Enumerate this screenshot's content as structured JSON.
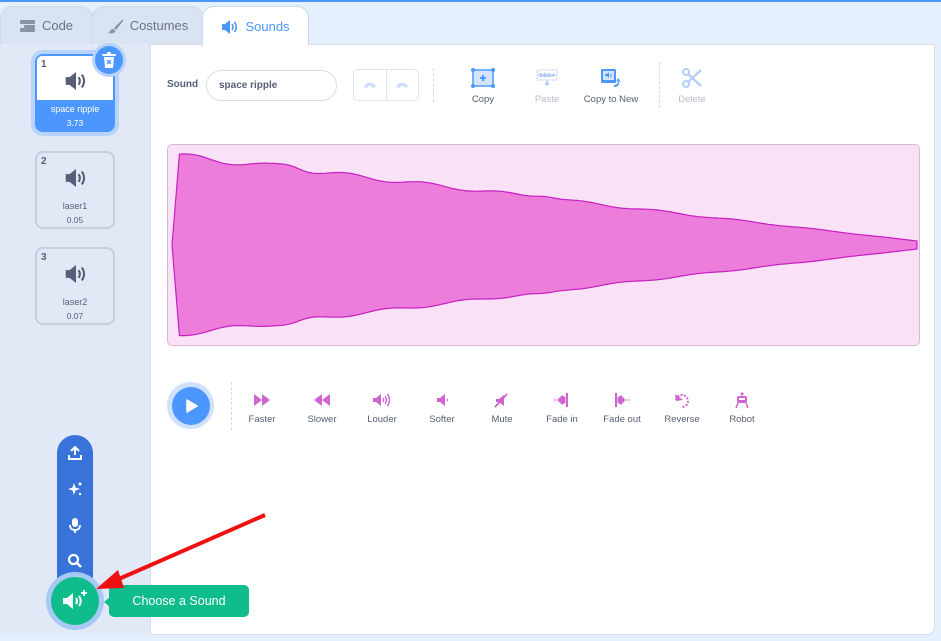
{
  "tabs": [
    {
      "label": "Code",
      "icon": "code-icon",
      "active": false
    },
    {
      "label": "Costumes",
      "icon": "brush-icon",
      "active": false
    },
    {
      "label": "Sounds",
      "icon": "speaker-icon",
      "active": true
    }
  ],
  "sounds": [
    {
      "index": "1",
      "name": "space ripple",
      "duration": "3.73",
      "selected": true
    },
    {
      "index": "2",
      "name": "laser1",
      "duration": "0.05",
      "selected": false
    },
    {
      "index": "3",
      "name": "laser2",
      "duration": "0.07",
      "selected": false
    }
  ],
  "editor": {
    "sound_label": "Sound",
    "sound_name": "space ripple",
    "tools": {
      "copy": "Copy",
      "paste": "Paste",
      "copy_to_new": "Copy to New",
      "delete": "Delete"
    },
    "effects": [
      "Faster",
      "Slower",
      "Louder",
      "Softer",
      "Mute",
      "Fade in",
      "Fade out",
      "Reverse",
      "Robot"
    ]
  },
  "add_menu": {
    "items": [
      "upload-sound",
      "surprise",
      "record",
      "choose-sound-search"
    ],
    "tooltip": "Choose a Sound"
  },
  "colors": {
    "accent": "#4c97ff",
    "sound_pink": "#cf63cf",
    "wave_fill": "#ec7ddb",
    "wave_stroke": "#c71fc1",
    "wave_bg": "#f9e2f7",
    "choose_green": "#0fbd8c",
    "arrow_red": "#ee1111"
  }
}
